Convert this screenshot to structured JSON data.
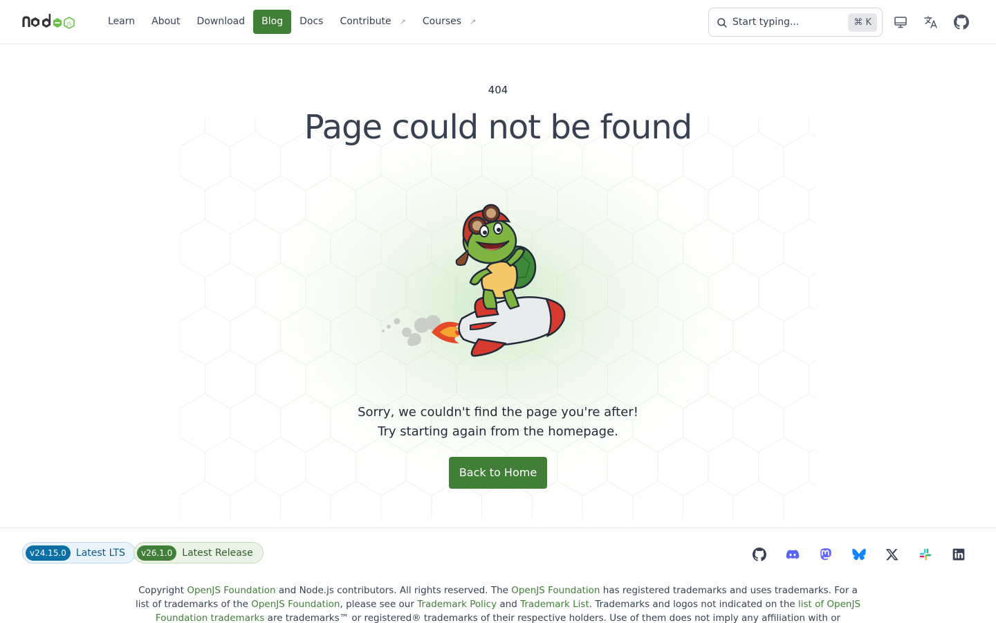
{
  "header": {
    "logo_alt": "node js",
    "nav": [
      {
        "label": "Learn",
        "active": false,
        "external": false
      },
      {
        "label": "About",
        "active": false,
        "external": false
      },
      {
        "label": "Download",
        "active": false,
        "external": false
      },
      {
        "label": "Blog",
        "active": true,
        "external": false
      },
      {
        "label": "Docs",
        "active": false,
        "external": false
      },
      {
        "label": "Contribute",
        "active": false,
        "external": true
      },
      {
        "label": "Courses",
        "active": false,
        "external": true
      }
    ],
    "search": {
      "placeholder": "Start typing...",
      "shortcut": "⌘ K"
    },
    "icons": [
      "theme-monitor-icon",
      "language-icon",
      "github-icon"
    ]
  },
  "main": {
    "code": "404",
    "title": "Page could not be found",
    "message_line1": "Sorry, we couldn't find the page you're after!",
    "message_line2": "Try starting again from the homepage.",
    "button": "Back to Home"
  },
  "footer": {
    "lts": {
      "version": "v24.15.0",
      "label": "Latest LTS"
    },
    "current": {
      "version": "v26.1.0",
      "label": "Latest Release"
    },
    "social": [
      "github-icon",
      "discord-icon",
      "mastodon-icon",
      "bluesky-icon",
      "x-icon",
      "slack-icon",
      "linkedin-icon"
    ],
    "copyright": {
      "t1": "Copyright ",
      "link1": "OpenJS Foundation",
      "t2": " and Node.js contributors. All rights reserved. The ",
      "link2": "OpenJS Foundation",
      "t3": " has registered trademarks and uses trademarks. For a list of trademarks of the ",
      "link3": "OpenJS Foundation",
      "t4": ", please see our ",
      "link4": "Trademark Policy",
      "t5": " and ",
      "link5": "Trademark List",
      "t6": ". Trademarks and logos not indicated on the ",
      "link6": "list of OpenJS Foundation trademarks",
      "t7": " are trademarks™ or registered® trademarks of their respective holders. Use of them does not imply any affiliation with or endorsement by them."
    }
  },
  "colors": {
    "brand_green": "#417e38",
    "lts_blue": "#0b6fa8",
    "text": "#1f2937"
  }
}
